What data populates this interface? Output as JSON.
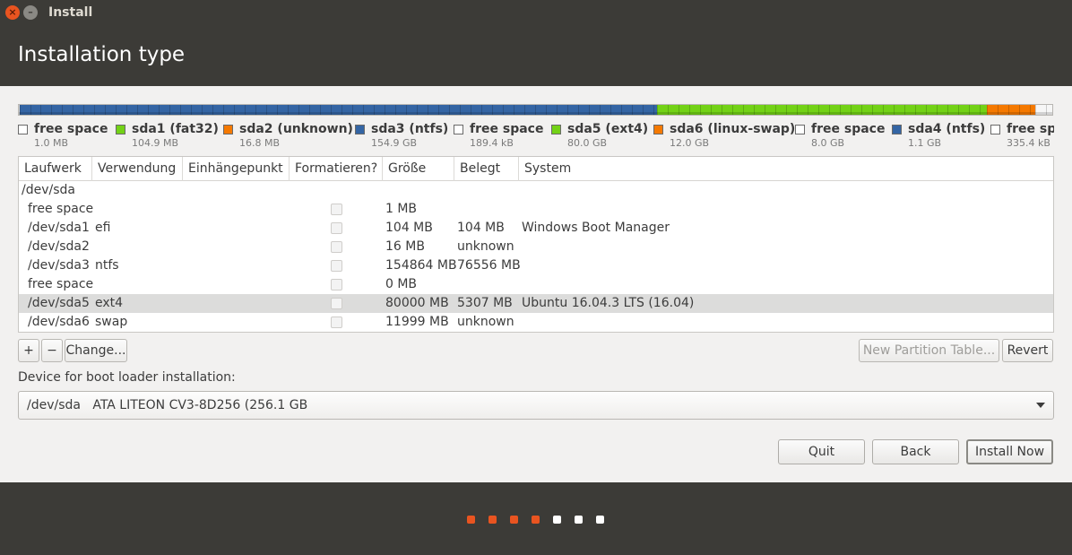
{
  "window": {
    "title": "Install",
    "close_symbol": "×",
    "minimize_symbol": "–"
  },
  "header": {
    "title": "Installation type"
  },
  "partition_bar": {
    "segments": [
      {
        "name": "free space",
        "color": "#ffffff",
        "fraction": 0.001
      },
      {
        "name": "sda1 (fat32)",
        "color": "#3465a4",
        "fraction": 0.02
      },
      {
        "name": "sda2 (unknown)",
        "color": "#3465a4",
        "fraction": 0.01
      },
      {
        "name": "sda3 (ntfs)",
        "color": "#3465a4",
        "fraction": 0.586
      },
      {
        "name": "sda5 (ext4)",
        "color": "#73d216",
        "fraction": 0.319
      },
      {
        "name": "sda6 (linux-swap)",
        "color": "#f57900",
        "fraction": 0.047
      },
      {
        "name": "free space",
        "color": "#f6f6f6",
        "fraction": 0.017
      }
    ]
  },
  "legend": [
    {
      "name": "free space",
      "size": "1.0 MB",
      "color": "#ffffff"
    },
    {
      "name": "sda1 (fat32)",
      "size": "104.9 MB",
      "color": "#73d216"
    },
    {
      "name": "sda2 (unknown)",
      "size": "16.8 MB",
      "color": "#f57900"
    },
    {
      "name": "sda3 (ntfs)",
      "size": "154.9 GB",
      "color": "#3465a4"
    },
    {
      "name": "free space",
      "size": "189.4 kB",
      "color": "#ffffff"
    },
    {
      "name": "sda5 (ext4)",
      "size": "80.0 GB",
      "color": "#73d216"
    },
    {
      "name": "sda6 (linux-swap)",
      "size": "12.0 GB",
      "color": "#f57900"
    },
    {
      "name": "free space",
      "size": "8.0 GB",
      "color": "#ffffff"
    },
    {
      "name": "sda4 (ntfs)",
      "size": "1.1 GB",
      "color": "#3465a4"
    },
    {
      "name": "free spa",
      "size": "335.4 kB",
      "color": "#ffffff"
    }
  ],
  "table": {
    "columns": [
      "Laufwerk",
      "Verwendung",
      "Einhängepunkt",
      "Formatieren?",
      "Größe",
      "Belegt",
      "System"
    ],
    "device_row": "/dev/sda",
    "rows": [
      {
        "device": "free space",
        "use": "",
        "mount": "",
        "format": false,
        "size": "1 MB",
        "used": "",
        "system": ""
      },
      {
        "device": "/dev/sda1",
        "use": "efi",
        "mount": "",
        "format": false,
        "size": "104 MB",
        "used": "104 MB",
        "system": "Windows Boot Manager"
      },
      {
        "device": "/dev/sda2",
        "use": "",
        "mount": "",
        "format": false,
        "size": "16 MB",
        "used": "unknown",
        "system": ""
      },
      {
        "device": "/dev/sda3",
        "use": "ntfs",
        "mount": "",
        "format": false,
        "size": "154864 MB",
        "used": "76556 MB",
        "system": ""
      },
      {
        "device": "free space",
        "use": "",
        "mount": "",
        "format": false,
        "size": "0 MB",
        "used": "",
        "system": ""
      },
      {
        "device": "/dev/sda5",
        "use": "ext4",
        "mount": "",
        "format": false,
        "size": "80000 MB",
        "used": "5307 MB",
        "system": "Ubuntu 16.04.3 LTS (16.04)",
        "selected": true
      },
      {
        "device": "/dev/sda6",
        "use": "swap",
        "mount": "",
        "format": false,
        "size": "11999 MB",
        "used": "unknown",
        "system": ""
      }
    ]
  },
  "table_buttons": {
    "add": "+",
    "remove": "−",
    "change": "Change...",
    "new_partition_table": "New Partition Table...",
    "revert": "Revert"
  },
  "bootloader": {
    "label": "Device for boot loader installation:",
    "selected": "/dev/sda   ATA LITEON CV3-8D256 (256.1 GB"
  },
  "actions": {
    "quit": "Quit",
    "back": "Back",
    "install_now": "Install Now"
  },
  "progress": {
    "steps_total": 7,
    "steps_done": 4,
    "done_color": "#e95420",
    "pending_color": "#ffffff"
  }
}
